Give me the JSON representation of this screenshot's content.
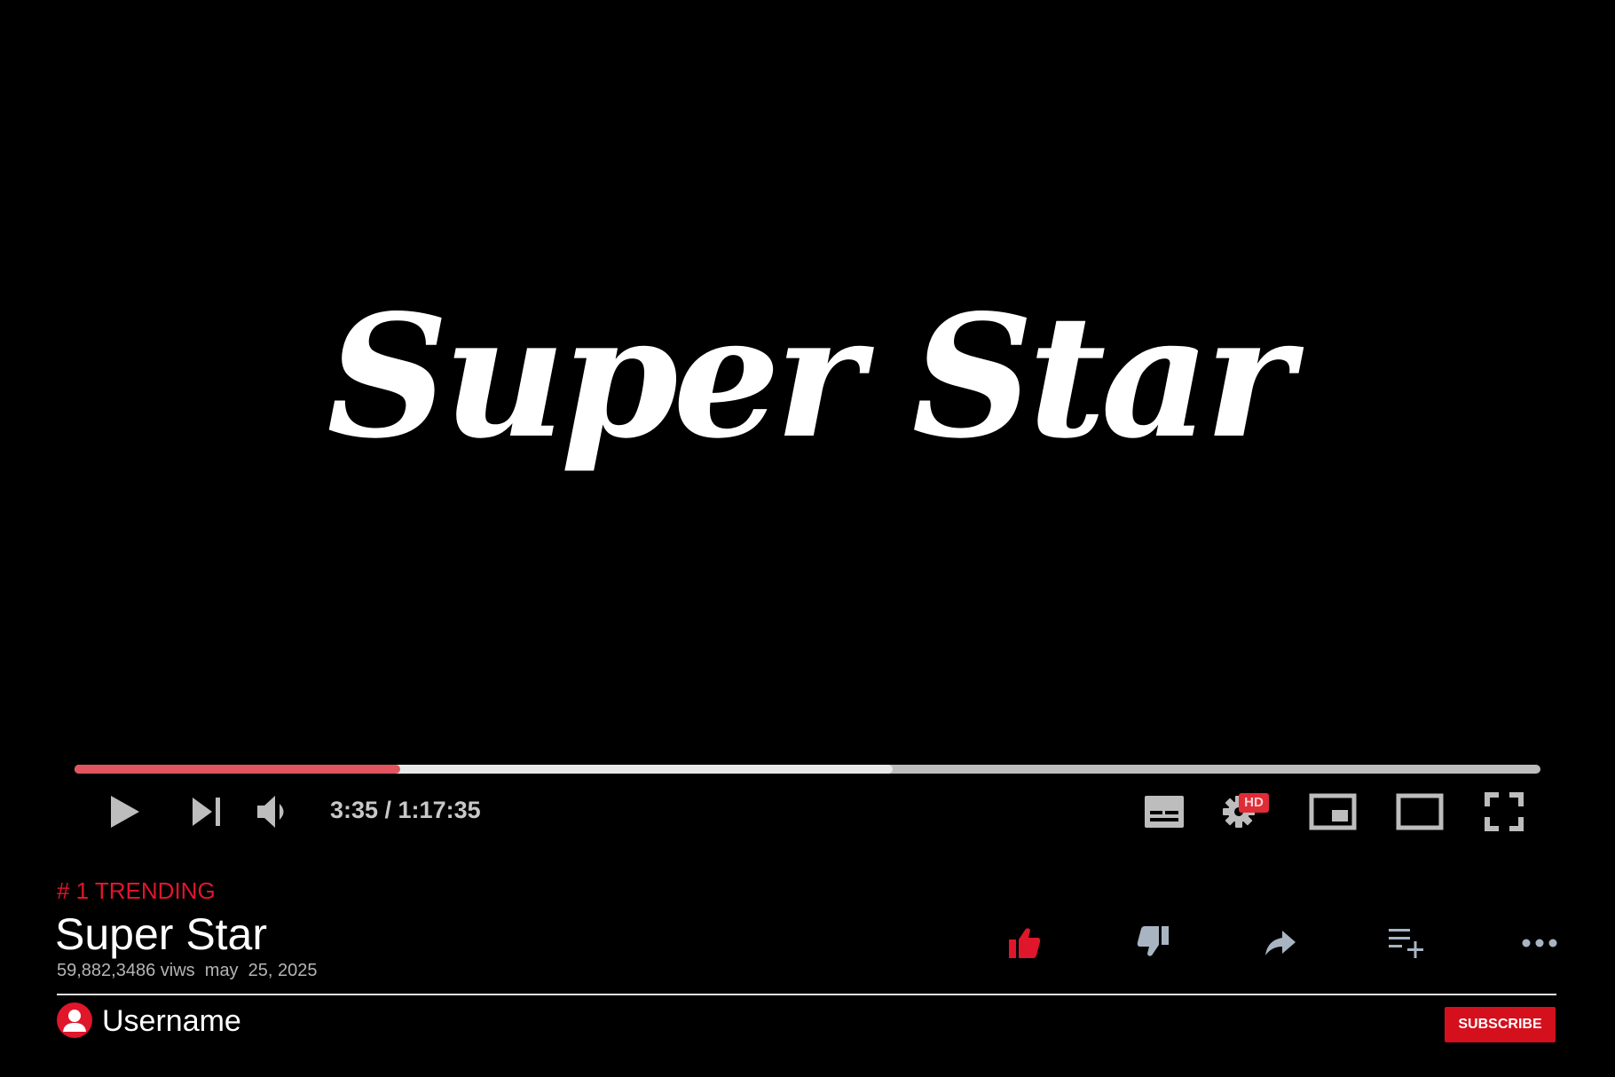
{
  "video": {
    "title_art": "Super Star"
  },
  "player": {
    "time_display": "3:35 / 1:17:35",
    "current_time": "3:35",
    "duration": "1:17:35",
    "played_fraction": 0.222,
    "buffered_fraction": 0.558,
    "quality_badge": "HD",
    "colors": {
      "played": "#e05560",
      "buffered": "#e8e8e8",
      "track": "#bdbdbd",
      "icon": "#bdbdbd",
      "badge": "#e02c36"
    },
    "icons": [
      "play-icon",
      "next-icon",
      "volume-icon",
      "captions-icon",
      "settings-icon",
      "miniplayer-icon",
      "theater-mode-icon",
      "fullscreen-icon"
    ]
  },
  "info": {
    "trending_label": "# 1 TRENDING",
    "title": "Super Star",
    "meta": "59,882,3486 viws  may  25, 2025",
    "actions": [
      "like-icon",
      "dislike-icon",
      "share-icon",
      "add-to-playlist-icon",
      "more-options-icon"
    ],
    "colors": {
      "accent": "#e0162b",
      "like_active": "#e0162b",
      "action_icon": "#a9b4c2"
    }
  },
  "channel": {
    "username": "Username",
    "subscribe_label": "SUBSCRIBE",
    "subscribe_color": "#d4101c"
  }
}
